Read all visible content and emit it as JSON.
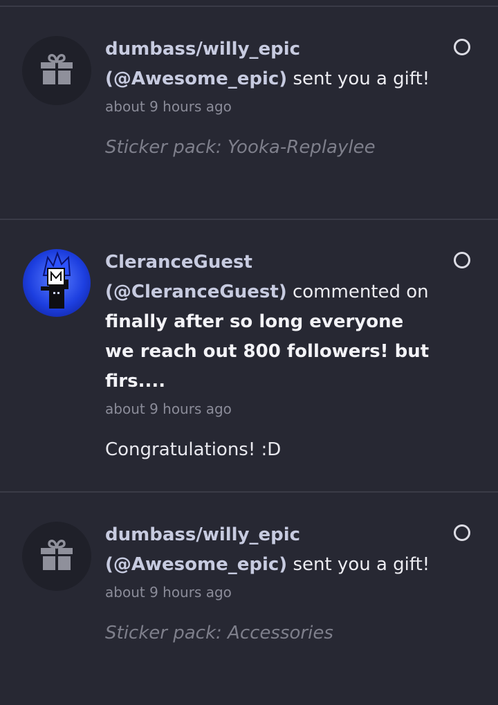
{
  "notifications": [
    {
      "actor_name": "dumbass/willy_epic",
      "actor_handle": "(@Awesome_epic)",
      "action": "sent you a gift!",
      "time": "about 9 hours ago",
      "detail": "Sticker pack: Yooka-Replaylee",
      "avatar_icon": "gift-icon"
    },
    {
      "actor_name": "CleranceGuest",
      "actor_handle": "(@CleranceGuest)",
      "action_prefix": "commented on",
      "post_title": "finally after so long everyone we reach out 800 followers! but firs....",
      "time": "about 9 hours ago",
      "detail": "Congratulations! :D",
      "avatar_icon": "user-avatar"
    },
    {
      "actor_name": "dumbass/willy_epic",
      "actor_handle": "(@Awesome_epic)",
      "action": "sent you a gift!",
      "time": "about 9 hours ago",
      "detail": "Sticker pack: Accessories",
      "avatar_icon": "gift-icon"
    }
  ],
  "colors": {
    "background": "#272833",
    "divider": "#3a3b47",
    "text_primary": "#ececf1",
    "text_secondary": "#8b8c99",
    "avatar_blue": "#1d3fe0"
  }
}
